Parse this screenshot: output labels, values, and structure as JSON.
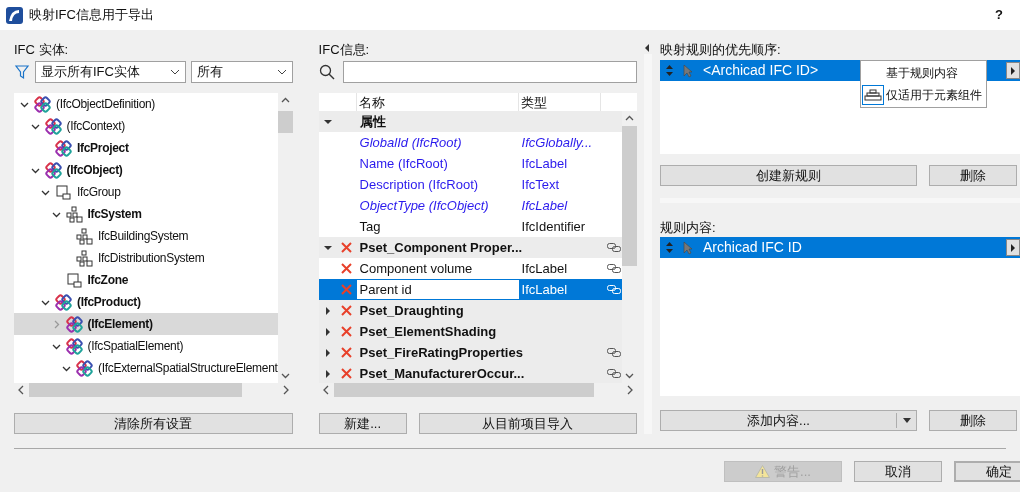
{
  "window": {
    "title": "映射IFC信息用于导出",
    "help": "?"
  },
  "entities": {
    "label": "IFC 实体:",
    "filter": "显示所有IFC实体",
    "scope": "所有",
    "tree": [
      {
        "text": "(IfcObjectDefinition)",
        "kind": "ifc",
        "bold": false,
        "selected": false,
        "expanded": true,
        "children": [
          {
            "text": "(IfcContext)",
            "kind": "ifc",
            "bold": false,
            "selected": false,
            "expanded": true,
            "children": [
              {
                "text": "IfcProject",
                "kind": "ifc",
                "bold": true,
                "selected": false
              }
            ]
          },
          {
            "text": "(IfcObject)",
            "kind": "ifc",
            "bold": true,
            "selected": false,
            "expanded": true,
            "children": [
              {
                "text": "IfcGroup",
                "kind": "group",
                "bold": false,
                "selected": false,
                "expanded": true,
                "children": [
                  {
                    "text": "IfcSystem",
                    "kind": "system",
                    "bold": true,
                    "selected": false,
                    "expanded": true,
                    "children": [
                      {
                        "text": "IfcBuildingSystem",
                        "kind": "system",
                        "bold": false,
                        "selected": false
                      },
                      {
                        "text": "IfcDistributionSystem",
                        "kind": "system",
                        "bold": false,
                        "selected": false
                      }
                    ]
                  },
                  {
                    "text": "IfcZone",
                    "kind": "group",
                    "bold": true,
                    "selected": false
                  }
                ]
              },
              {
                "text": "(IfcProduct)",
                "kind": "ifc",
                "bold": true,
                "selected": false,
                "expanded": true,
                "children": [
                  {
                    "text": "(IfcElement)",
                    "kind": "ifc",
                    "bold": true,
                    "selected": true,
                    "expanded": false
                  },
                  {
                    "text": "(IfcSpatialElement)",
                    "kind": "ifc",
                    "bold": false,
                    "selected": false,
                    "expanded": true,
                    "children": [
                      {
                        "text": "(IfcExternalSpatialStructureElement",
                        "kind": "ifc",
                        "bold": false,
                        "selected": false,
                        "expanded": true
                      }
                    ]
                  }
                ]
              }
            ]
          }
        ]
      }
    ],
    "button": "清除所有设置"
  },
  "info": {
    "label": "IFC信息:",
    "columns": [
      "名称",
      "类型"
    ],
    "rows": [
      {
        "kind": "group",
        "name": "属性",
        "expanded": true,
        "removable": false,
        "linked": false,
        "selected": false
      },
      {
        "kind": "attribute",
        "name": "GlobalId (IfcRoot)",
        "type": "IfcGlobally...",
        "italic": true,
        "inherited": true,
        "selected": false
      },
      {
        "kind": "attribute",
        "name": "Name (IfcRoot)",
        "type": "IfcLabel",
        "italic": false,
        "inherited": true,
        "selected": false
      },
      {
        "kind": "attribute",
        "name": "Description (IfcRoot)",
        "type": "IfcText",
        "italic": false,
        "inherited": true,
        "selected": false
      },
      {
        "kind": "attribute",
        "name": "ObjectType (IfcObject)",
        "type": "IfcLabel",
        "italic": true,
        "inherited": true,
        "selected": false
      },
      {
        "kind": "attribute",
        "name": "Tag",
        "type": "IfcIdentifier",
        "italic": false,
        "inherited": false,
        "selected": false
      },
      {
        "kind": "group",
        "name": "Pset_Component Proper...",
        "expanded": true,
        "removable": true,
        "linked": true,
        "selected": false
      },
      {
        "kind": "property",
        "name": "Component volume",
        "type": "IfcLabel",
        "removable": true,
        "linked": true,
        "selected": false
      },
      {
        "kind": "property",
        "name": "Parent id",
        "type": "IfcLabel",
        "removable": true,
        "linked": true,
        "selected": true
      },
      {
        "kind": "group",
        "name": "Pset_Draughting",
        "expanded": false,
        "removable": true,
        "linked": false,
        "selected": false
      },
      {
        "kind": "group",
        "name": "Pset_ElementShading",
        "expanded": false,
        "removable": true,
        "linked": false,
        "selected": false
      },
      {
        "kind": "group",
        "name": "Pset_FireRatingProperties",
        "expanded": false,
        "removable": true,
        "linked": true,
        "selected": false
      },
      {
        "kind": "group",
        "name": "Pset_ManufacturerOccur...",
        "expanded": false,
        "removable": true,
        "linked": true,
        "selected": false
      }
    ],
    "buttons": [
      "新建...",
      "从目前项目导入"
    ]
  },
  "rules": {
    "label": "映射规则的优先顺序:",
    "items": [
      {
        "text": "<Archicad IFC ID>",
        "selected": true
      }
    ],
    "menu": [
      {
        "text": "基于规则内容",
        "checked": false
      },
      {
        "text": "仅适用于元素组件",
        "checked": true
      }
    ],
    "create_button": "创建新规则",
    "delete_button": "删除"
  },
  "content": {
    "label": "规则内容:",
    "items": [
      {
        "text": "Archicad IFC ID",
        "selected": true
      }
    ],
    "add_button": "添加内容...",
    "delete_button": "删除"
  },
  "footer": {
    "buttons": [
      {
        "text": "警告...",
        "disabled": true,
        "default": false
      },
      {
        "text": "取消",
        "disabled": false,
        "default": false
      },
      {
        "text": "确定",
        "disabled": false,
        "default": true
      }
    ]
  }
}
